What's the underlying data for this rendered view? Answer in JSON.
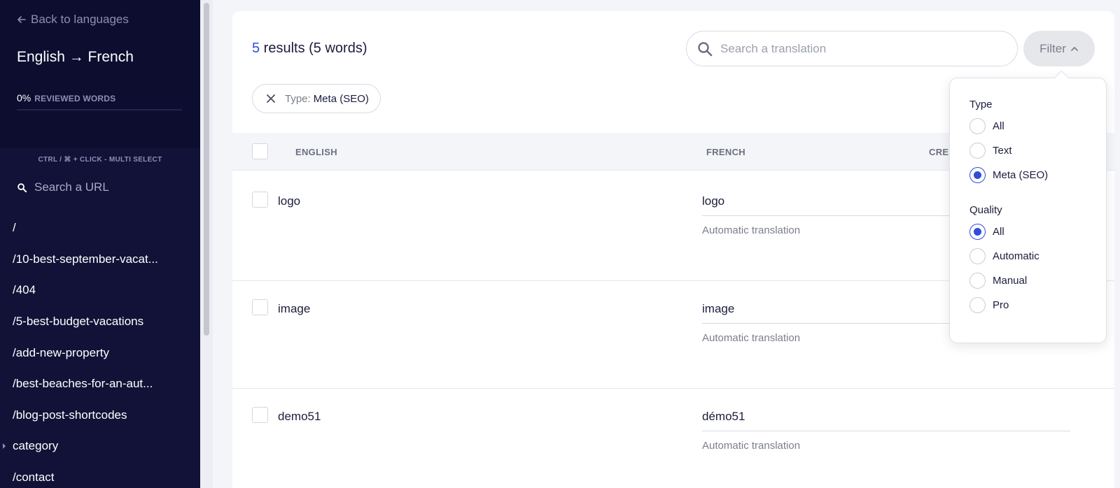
{
  "sidebar": {
    "back_label": "Back to languages",
    "language_pair": "English → French",
    "progress_percent": "0%",
    "progress_label": "REVIEWED WORDS",
    "multi_select_hint": "CTRL / ⌘ + CLICK - MULTI SELECT",
    "search_placeholder": "Search a URL",
    "urls": [
      {
        "label": "/",
        "has_children": false
      },
      {
        "label": "/10-best-september-vacat...",
        "has_children": false
      },
      {
        "label": "/404",
        "has_children": false
      },
      {
        "label": "/5-best-budget-vacations",
        "has_children": false
      },
      {
        "label": "/add-new-property",
        "has_children": false
      },
      {
        "label": "/best-beaches-for-an-aut...",
        "has_children": false
      },
      {
        "label": "/blog-post-shortcodes",
        "has_children": false
      },
      {
        "label": "category",
        "has_children": true
      },
      {
        "label": "/contact",
        "has_children": false
      }
    ]
  },
  "main": {
    "results_count": "5",
    "results_text": " results (5 words)",
    "search_placeholder": "Search a translation",
    "filter_label": "Filter",
    "active_filter": {
      "key": "Type:",
      "value": "Meta (SEO)"
    },
    "columns": {
      "source": "ENGLISH",
      "target": "FRENCH",
      "created": "CRE"
    },
    "rows": [
      {
        "source": "logo",
        "target": "logo",
        "quality": "Automatic translation"
      },
      {
        "source": "image",
        "target": "image",
        "quality": "Automatic translation"
      },
      {
        "source": "demo51",
        "target": "démo51",
        "quality": "Automatic translation"
      }
    ]
  },
  "filter_menu": {
    "type_heading": "Type",
    "type_options": [
      "All",
      "Text",
      "Meta (SEO)"
    ],
    "type_selected": "Meta (SEO)",
    "quality_heading": "Quality",
    "quality_options": [
      "All",
      "Automatic",
      "Manual",
      "Pro"
    ],
    "quality_selected": "All"
  },
  "colors": {
    "sidebar_bg": "#121238",
    "accent": "#2f4cdd"
  }
}
